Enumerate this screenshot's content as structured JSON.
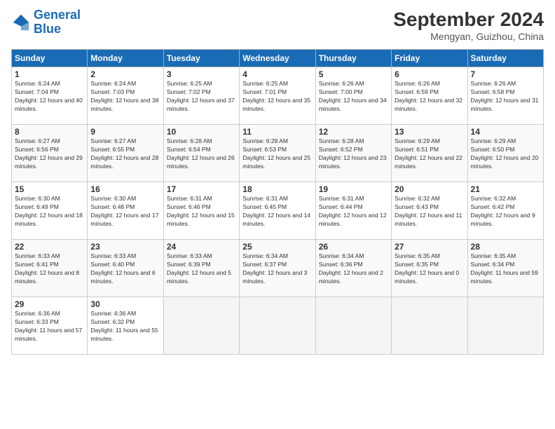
{
  "header": {
    "logo_line1": "General",
    "logo_line2": "Blue",
    "month": "September 2024",
    "location": "Mengyan, Guizhou, China"
  },
  "weekdays": [
    "Sunday",
    "Monday",
    "Tuesday",
    "Wednesday",
    "Thursday",
    "Friday",
    "Saturday"
  ],
  "weeks": [
    [
      {
        "day": "1",
        "sunrise": "6:24 AM",
        "sunset": "7:04 PM",
        "daylight": "12 hours and 40 minutes."
      },
      {
        "day": "2",
        "sunrise": "6:24 AM",
        "sunset": "7:03 PM",
        "daylight": "12 hours and 38 minutes."
      },
      {
        "day": "3",
        "sunrise": "6:25 AM",
        "sunset": "7:02 PM",
        "daylight": "12 hours and 37 minutes."
      },
      {
        "day": "4",
        "sunrise": "6:25 AM",
        "sunset": "7:01 PM",
        "daylight": "12 hours and 35 minutes."
      },
      {
        "day": "5",
        "sunrise": "6:26 AM",
        "sunset": "7:00 PM",
        "daylight": "12 hours and 34 minutes."
      },
      {
        "day": "6",
        "sunrise": "6:26 AM",
        "sunset": "6:59 PM",
        "daylight": "12 hours and 32 minutes."
      },
      {
        "day": "7",
        "sunrise": "6:26 AM",
        "sunset": "6:58 PM",
        "daylight": "12 hours and 31 minutes."
      }
    ],
    [
      {
        "day": "8",
        "sunrise": "6:27 AM",
        "sunset": "6:56 PM",
        "daylight": "12 hours and 29 minutes."
      },
      {
        "day": "9",
        "sunrise": "6:27 AM",
        "sunset": "6:55 PM",
        "daylight": "12 hours and 28 minutes."
      },
      {
        "day": "10",
        "sunrise": "6:28 AM",
        "sunset": "6:54 PM",
        "daylight": "12 hours and 26 minutes."
      },
      {
        "day": "11",
        "sunrise": "6:28 AM",
        "sunset": "6:53 PM",
        "daylight": "12 hours and 25 minutes."
      },
      {
        "day": "12",
        "sunrise": "6:28 AM",
        "sunset": "6:52 PM",
        "daylight": "12 hours and 23 minutes."
      },
      {
        "day": "13",
        "sunrise": "6:29 AM",
        "sunset": "6:51 PM",
        "daylight": "12 hours and 22 minutes."
      },
      {
        "day": "14",
        "sunrise": "6:29 AM",
        "sunset": "6:50 PM",
        "daylight": "12 hours and 20 minutes."
      }
    ],
    [
      {
        "day": "15",
        "sunrise": "6:30 AM",
        "sunset": "6:49 PM",
        "daylight": "12 hours and 18 minutes."
      },
      {
        "day": "16",
        "sunrise": "6:30 AM",
        "sunset": "6:48 PM",
        "daylight": "12 hours and 17 minutes."
      },
      {
        "day": "17",
        "sunrise": "6:31 AM",
        "sunset": "6:46 PM",
        "daylight": "12 hours and 15 minutes."
      },
      {
        "day": "18",
        "sunrise": "6:31 AM",
        "sunset": "6:45 PM",
        "daylight": "12 hours and 14 minutes."
      },
      {
        "day": "19",
        "sunrise": "6:31 AM",
        "sunset": "6:44 PM",
        "daylight": "12 hours and 12 minutes."
      },
      {
        "day": "20",
        "sunrise": "6:32 AM",
        "sunset": "6:43 PM",
        "daylight": "12 hours and 11 minutes."
      },
      {
        "day": "21",
        "sunrise": "6:32 AM",
        "sunset": "6:42 PM",
        "daylight": "12 hours and 9 minutes."
      }
    ],
    [
      {
        "day": "22",
        "sunrise": "6:33 AM",
        "sunset": "6:41 PM",
        "daylight": "12 hours and 8 minutes."
      },
      {
        "day": "23",
        "sunrise": "6:33 AM",
        "sunset": "6:40 PM",
        "daylight": "12 hours and 6 minutes."
      },
      {
        "day": "24",
        "sunrise": "6:33 AM",
        "sunset": "6:39 PM",
        "daylight": "12 hours and 5 minutes."
      },
      {
        "day": "25",
        "sunrise": "6:34 AM",
        "sunset": "6:37 PM",
        "daylight": "12 hours and 3 minutes."
      },
      {
        "day": "26",
        "sunrise": "6:34 AM",
        "sunset": "6:36 PM",
        "daylight": "12 hours and 2 minutes."
      },
      {
        "day": "27",
        "sunrise": "6:35 AM",
        "sunset": "6:35 PM",
        "daylight": "12 hours and 0 minutes."
      },
      {
        "day": "28",
        "sunrise": "6:35 AM",
        "sunset": "6:34 PM",
        "daylight": "11 hours and 59 minutes."
      }
    ],
    [
      {
        "day": "29",
        "sunrise": "6:36 AM",
        "sunset": "6:33 PM",
        "daylight": "11 hours and 57 minutes."
      },
      {
        "day": "30",
        "sunrise": "6:36 AM",
        "sunset": "6:32 PM",
        "daylight": "11 hours and 55 minutes."
      },
      null,
      null,
      null,
      null,
      null
    ]
  ]
}
